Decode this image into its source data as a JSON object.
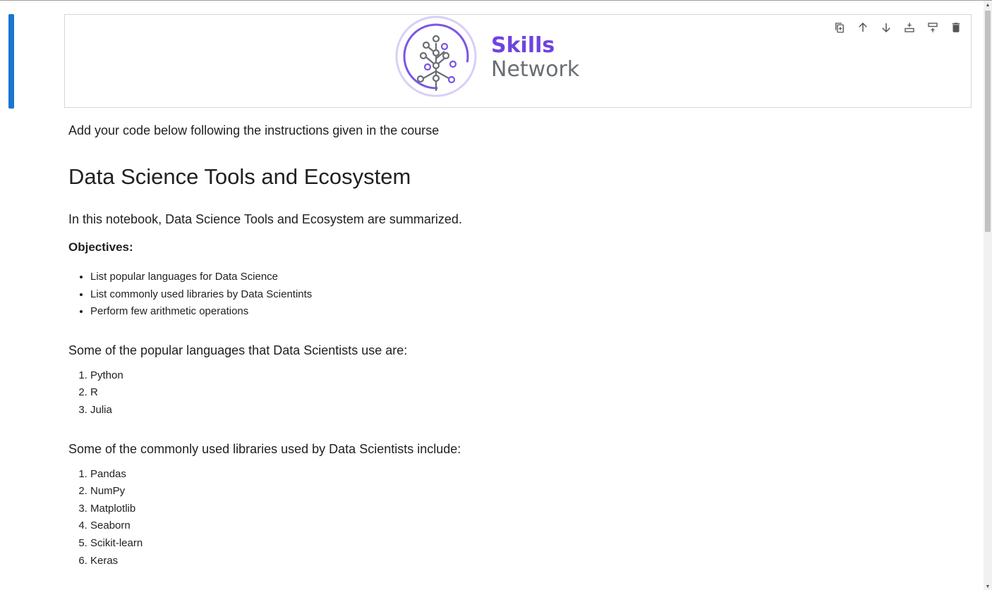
{
  "logo": {
    "line1": "Skills",
    "line2": "Network",
    "brand_color": "#6f43e0",
    "gray_color": "#6a6e73"
  },
  "toolbar": {
    "icons": [
      "duplicate-cell-icon",
      "move-up-icon",
      "move-down-icon",
      "insert-cell-below-icon",
      "insert-cell-above-icon",
      "delete-cell-icon"
    ]
  },
  "content": {
    "intro": "Add your code below following the instructions given in the course",
    "title": "Data Science Tools and Ecosystem",
    "summary": "In this notebook, Data Science Tools and Ecosystem are summarized.",
    "objectives_label": "Objectives:",
    "objectives": [
      "List popular languages for Data Science",
      "List commonly used libraries by Data Scientints",
      "Perform few arithmetic operations"
    ],
    "languages_intro": "Some of the popular languages that Data Scientists use are:",
    "languages": [
      "Python",
      "R",
      "Julia"
    ],
    "libraries_intro": "Some of the commonly used libraries used by Data Scientists include:",
    "libraries": [
      "Pandas",
      "NumPy",
      "Matplotlib",
      "Seaborn",
      "Scikit-learn",
      "Keras"
    ]
  },
  "colors": {
    "active_cell_bar": "#1976d2"
  }
}
